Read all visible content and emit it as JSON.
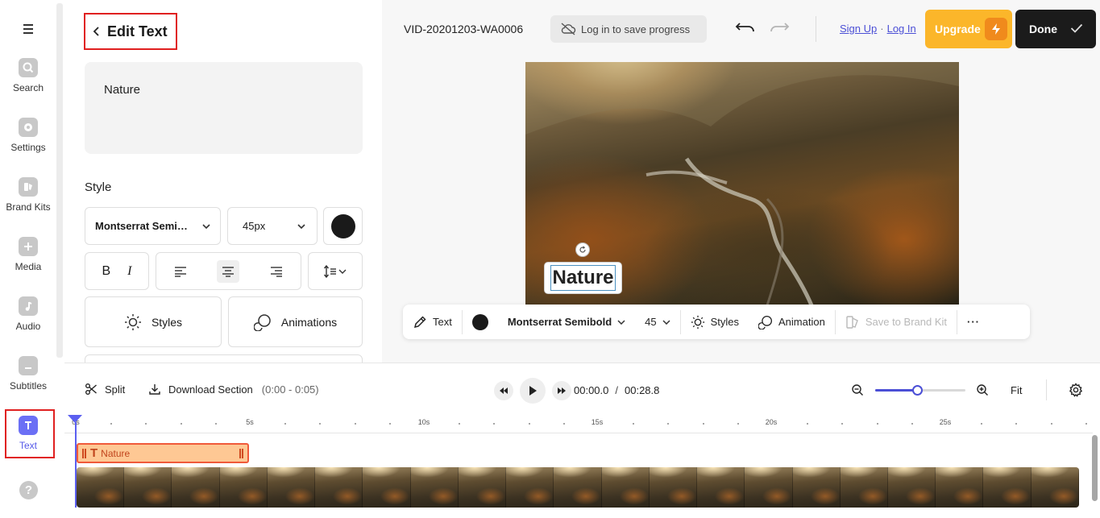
{
  "rail": {
    "items": [
      {
        "label": "Search",
        "icon": "search-icon"
      },
      {
        "label": "Settings",
        "icon": "gear-icon"
      },
      {
        "label": "Brand Kits",
        "icon": "brand-kit-icon"
      },
      {
        "label": "Media",
        "icon": "plus-icon"
      },
      {
        "label": "Audio",
        "icon": "music-note-icon"
      },
      {
        "label": "Subtitles",
        "icon": "subtitles-icon"
      },
      {
        "label": "Text",
        "icon": "text-icon",
        "active": true
      }
    ],
    "help": "?"
  },
  "panel": {
    "back_title": "Edit Text",
    "text_value": "Nature",
    "style_label": "Style",
    "font": "Montserrat Semi…",
    "size": "45px",
    "color": "#1a1a1a",
    "bold": "B",
    "italic": "I",
    "styles_label": "Styles",
    "animations_label": "Animations"
  },
  "topbar": {
    "title": "VID-20201203-WA0006",
    "save_progress": "Log in to save progress",
    "sign_up": "Sign Up",
    "separator": "·",
    "log_in": "Log In",
    "upgrade": "Upgrade",
    "done": "Done"
  },
  "canvas": {
    "overlay_text": "Nature",
    "toolbar": {
      "text": "Text",
      "font": "Montserrat Semibold",
      "size": "45",
      "styles": "Styles",
      "animation": "Animation",
      "save_brand_kit": "Save to Brand Kit",
      "more": "···"
    }
  },
  "timeline": {
    "split": "Split",
    "download": "Download Section",
    "range": "(0:00 - 0:05)",
    "current_time": "00:00.0",
    "time_sep": "/",
    "total_time": "00:28.8",
    "fit": "Fit",
    "zoom_level": 0.47,
    "ruler": [
      "0s",
      "5s",
      "10s",
      "15s",
      "20s",
      "25s"
    ],
    "text_clip": "Nature",
    "thumb_count": 21
  },
  "colors": {
    "accent": "#5458e8",
    "highlight": "#e02020",
    "upgrade": "#fbb62a",
    "clip_fill": "#fec894",
    "clip_border": "#f05a3a"
  }
}
